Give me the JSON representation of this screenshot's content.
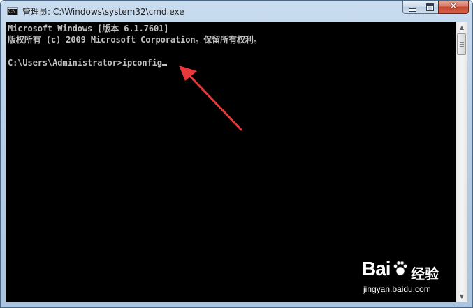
{
  "window": {
    "title": "管理员: C:\\Windows\\system32\\cmd.exe",
    "icon": "cmd-icon",
    "icon_glyph": "C:\\",
    "close_glyph": "✕"
  },
  "console": {
    "lines": [
      "Microsoft Windows [版本 6.1.7601]",
      "版权所有 (c) 2009 Microsoft Corporation。保留所有权利。",
      "",
      "C:\\Users\\Administrator>ipconfig"
    ],
    "text_color": "#c0c0c0",
    "background": "#000000"
  },
  "annotation": {
    "arrow_color": "#e8383b"
  },
  "watermark": {
    "brand": "Bai",
    "brand_suffix": "经验",
    "url": "jingyan.baidu.com"
  }
}
